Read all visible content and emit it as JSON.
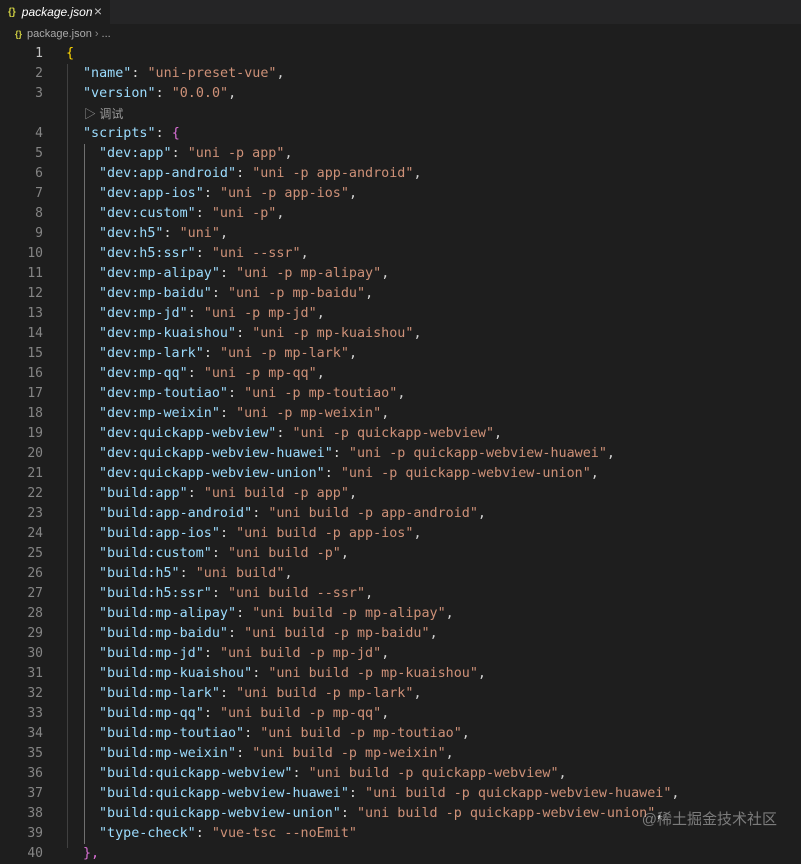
{
  "tab": {
    "icon_text": "{}",
    "label": "package.json",
    "close_glyph": "×"
  },
  "breadcrumb": {
    "icon_text": "{}",
    "file": "package.json",
    "separator": "›",
    "rest": "..."
  },
  "codelens": "▷ 调试",
  "watermark": "@稀土掘金技术社区",
  "colors": {
    "key": "#9cdcfe",
    "string": "#ce9178",
    "bracket1": "#ffd700",
    "bracket2": "#da70d6",
    "line_number": "#858585"
  },
  "editor": {
    "line_numbers": [
      "1",
      "2",
      "3",
      "4",
      "5",
      "6",
      "7",
      "8",
      "9",
      "10",
      "11",
      "12",
      "13",
      "14",
      "15",
      "16",
      "17",
      "18",
      "19",
      "20",
      "21",
      "22",
      "23",
      "24",
      "25",
      "26",
      "27",
      "28",
      "29",
      "30",
      "31",
      "32",
      "33",
      "34",
      "35",
      "36",
      "37",
      "38",
      "39",
      "40"
    ],
    "top_lines": [
      {
        "key": "\"name\"",
        "value": "\"uni-preset-vue\""
      },
      {
        "key": "\"version\"",
        "value": "\"0.0.0\""
      }
    ],
    "scripts_key": "\"scripts\"",
    "scripts": [
      {
        "key": "\"dev:app\"",
        "value": "\"uni -p app\""
      },
      {
        "key": "\"dev:app-android\"",
        "value": "\"uni -p app-android\""
      },
      {
        "key": "\"dev:app-ios\"",
        "value": "\"uni -p app-ios\""
      },
      {
        "key": "\"dev:custom\"",
        "value": "\"uni -p\""
      },
      {
        "key": "\"dev:h5\"",
        "value": "\"uni\""
      },
      {
        "key": "\"dev:h5:ssr\"",
        "value": "\"uni --ssr\""
      },
      {
        "key": "\"dev:mp-alipay\"",
        "value": "\"uni -p mp-alipay\""
      },
      {
        "key": "\"dev:mp-baidu\"",
        "value": "\"uni -p mp-baidu\""
      },
      {
        "key": "\"dev:mp-jd\"",
        "value": "\"uni -p mp-jd\""
      },
      {
        "key": "\"dev:mp-kuaishou\"",
        "value": "\"uni -p mp-kuaishou\""
      },
      {
        "key": "\"dev:mp-lark\"",
        "value": "\"uni -p mp-lark\""
      },
      {
        "key": "\"dev:mp-qq\"",
        "value": "\"uni -p mp-qq\""
      },
      {
        "key": "\"dev:mp-toutiao\"",
        "value": "\"uni -p mp-toutiao\""
      },
      {
        "key": "\"dev:mp-weixin\"",
        "value": "\"uni -p mp-weixin\""
      },
      {
        "key": "\"dev:quickapp-webview\"",
        "value": "\"uni -p quickapp-webview\""
      },
      {
        "key": "\"dev:quickapp-webview-huawei\"",
        "value": "\"uni -p quickapp-webview-huawei\""
      },
      {
        "key": "\"dev:quickapp-webview-union\"",
        "value": "\"uni -p quickapp-webview-union\""
      },
      {
        "key": "\"build:app\"",
        "value": "\"uni build -p app\""
      },
      {
        "key": "\"build:app-android\"",
        "value": "\"uni build -p app-android\""
      },
      {
        "key": "\"build:app-ios\"",
        "value": "\"uni build -p app-ios\""
      },
      {
        "key": "\"build:custom\"",
        "value": "\"uni build -p\""
      },
      {
        "key": "\"build:h5\"",
        "value": "\"uni build\""
      },
      {
        "key": "\"build:h5:ssr\"",
        "value": "\"uni build --ssr\""
      },
      {
        "key": "\"build:mp-alipay\"",
        "value": "\"uni build -p mp-alipay\""
      },
      {
        "key": "\"build:mp-baidu\"",
        "value": "\"uni build -p mp-baidu\""
      },
      {
        "key": "\"build:mp-jd\"",
        "value": "\"uni build -p mp-jd\""
      },
      {
        "key": "\"build:mp-kuaishou\"",
        "value": "\"uni build -p mp-kuaishou\""
      },
      {
        "key": "\"build:mp-lark\"",
        "value": "\"uni build -p mp-lark\""
      },
      {
        "key": "\"build:mp-qq\"",
        "value": "\"uni build -p mp-qq\""
      },
      {
        "key": "\"build:mp-toutiao\"",
        "value": "\"uni build -p mp-toutiao\""
      },
      {
        "key": "\"build:mp-weixin\"",
        "value": "\"uni build -p mp-weixin\""
      },
      {
        "key": "\"build:quickapp-webview\"",
        "value": "\"uni build -p quickapp-webview\""
      },
      {
        "key": "\"build:quickapp-webview-huawei\"",
        "value": "\"uni build -p quickapp-webview-huawei\""
      },
      {
        "key": "\"build:quickapp-webview-union\"",
        "value": "\"uni build -p quickapp-webview-union\""
      },
      {
        "key": "\"type-check\"",
        "value": "\"vue-tsc --noEmit\""
      }
    ]
  }
}
